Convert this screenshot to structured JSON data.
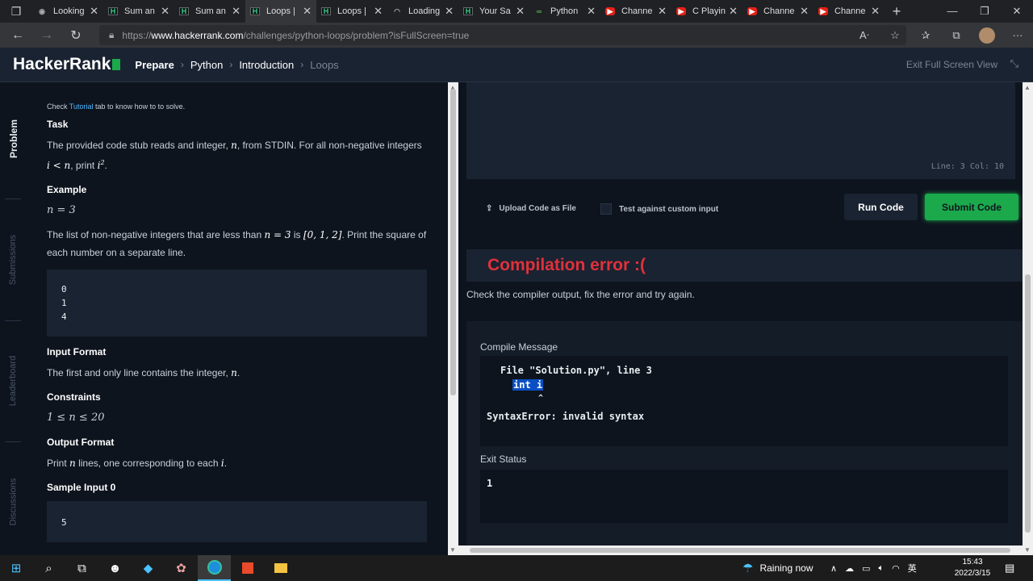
{
  "browser": {
    "tabs": [
      {
        "title": "Looking",
        "icon": "lens-icon"
      },
      {
        "title": "Sum an",
        "icon": "hackerrank-icon"
      },
      {
        "title": "Sum an",
        "icon": "hackerrank-icon"
      },
      {
        "title": "Loops |",
        "icon": "hackerrank-icon",
        "active": true
      },
      {
        "title": "Loops |",
        "icon": "hackerrank-icon"
      },
      {
        "title": "Loading",
        "icon": "loading-icon"
      },
      {
        "title": "Your Sa",
        "icon": "hackerrank-icon"
      },
      {
        "title": "Python",
        "icon": "python-icon"
      },
      {
        "title": "Channe",
        "icon": "youtube-icon"
      },
      {
        "title": "C Playin",
        "icon": "youtube-icon"
      },
      {
        "title": "Channe",
        "icon": "youtube-icon"
      },
      {
        "title": "Channe",
        "icon": "youtube-icon"
      }
    ],
    "url_prefix": "https://",
    "url_host": "www.hackerrank.com",
    "url_path": "/challenges/python-loops/problem?isFullScreen=true"
  },
  "header": {
    "logo": "HackerRank",
    "breadcrumbs": [
      "Prepare",
      "Python",
      "Introduction",
      "Loops"
    ],
    "exit_fullscreen": "Exit Full Screen View"
  },
  "side_tabs": [
    "Problem",
    "Submissions",
    "Leaderboard",
    "Discussions"
  ],
  "problem": {
    "tutorial_prefix": "Check ",
    "tutorial_link": "Tutorial",
    "tutorial_suffix": " tab to know how to to solve.",
    "task_heading": "Task",
    "task_text_1": "The provided code stub reads and integer, ",
    "task_n": "n",
    "task_text_2": ", from STDIN. For all non-negative integers",
    "task_cond": "i < n",
    "task_text_3": ", print ",
    "task_sq": "i",
    "task_sup": "2",
    "task_end": ".",
    "example_heading": "Example",
    "example_n": "n = 3",
    "example_text_1": "The list of non-negative integers that are less than ",
    "example_n2": "n = 3",
    "example_text_2": " is ",
    "example_list": "[0, 1, 2]",
    "example_text_3": ". Print the square of each number on a separate line.",
    "example_output": [
      "0",
      "1",
      "4"
    ],
    "input_heading": "Input Format",
    "input_text": "The first and only line contains the integer, ",
    "input_n": "n",
    "input_end": ".",
    "constraints_heading": "Constraints",
    "constraint": "1 ≤ n ≤ 20",
    "output_heading": "Output Format",
    "output_text_1": "Print ",
    "output_n": "n",
    "output_text_2": " lines, one corresponding to each ",
    "output_i": "i",
    "output_end": ".",
    "sample_heading": "Sample Input 0",
    "sample_input": "5"
  },
  "editor": {
    "line_col": "Line: 3 Col: 10",
    "upload_label": "Upload Code as File",
    "custom_input_label": "Test against custom input",
    "run_label": "Run Code",
    "submit_label": "Submit Code"
  },
  "result": {
    "title": "Compilation error :(",
    "subtitle": "Check the compiler output, fix the error and try again.",
    "compile_label": "Compile Message",
    "compile_line1": "File \"Solution.py\", line 3",
    "compile_line2": "int i",
    "compile_caret": "^",
    "compile_line4": "SyntaxError: invalid syntax",
    "exit_label": "Exit Status",
    "exit_value": "1"
  },
  "taskbar": {
    "weather": "Raining now",
    "lang": "英",
    "time": "15:43",
    "date": "2022/3/15"
  },
  "colors": {
    "accent_green": "#1ba94c",
    "error_red": "#e0313a",
    "bg_dark": "#0e141e"
  }
}
